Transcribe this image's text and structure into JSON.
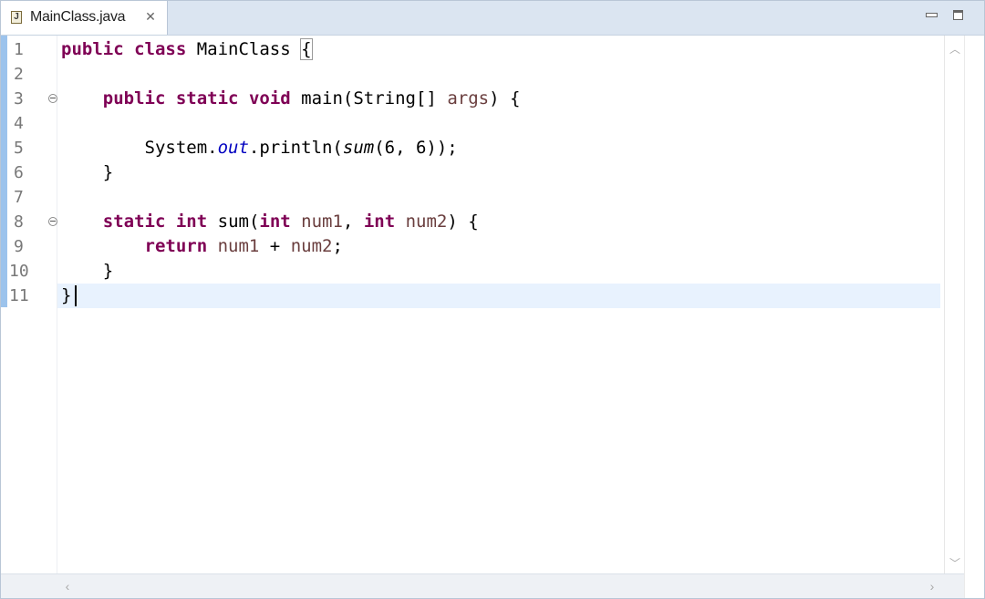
{
  "tab": {
    "title": "MainClass.java",
    "icon": "java-file-icon"
  },
  "window": {
    "minimize_icon": "minimize-icon",
    "maximize_icon": "maximize-icon"
  },
  "colors": {
    "keyword": "#7f0055",
    "field": "#0000c0",
    "param": "#6a3e3e",
    "current_line": "#e8f2fe",
    "ruler": "#9cc3ec"
  },
  "code": {
    "line_numbers": [
      "1",
      "2",
      "3",
      "4",
      "5",
      "6",
      "7",
      "8",
      "9",
      "10",
      "11"
    ],
    "l1": {
      "kw1": "public",
      "kw2": "class",
      "name": " MainClass ",
      "brace": "{"
    },
    "l3": {
      "indent": "    ",
      "kw1": "public",
      "kw2": "static",
      "kw3": "void",
      "name": " main(String[] ",
      "param": "args",
      "rest": ") {"
    },
    "l5": {
      "indent": "        ",
      "pre": "System.",
      "field": "out",
      "mid": ".println(",
      "method": "sum",
      "rest": "(6, 6));"
    },
    "l6": "    }",
    "l8": {
      "indent": "    ",
      "kw1": "static",
      "kw2": "int",
      "name": " sum(",
      "kw3": "int",
      "p1": " num1",
      "comma": ", ",
      "kw4": "int",
      "p2": " num2",
      "rest": ") {"
    },
    "l9": {
      "indent": "        ",
      "kw": "return",
      "p1": " num1",
      "op": " + ",
      "p2": "num2",
      "rest": ";"
    },
    "l10": "    }",
    "l11": "}"
  }
}
